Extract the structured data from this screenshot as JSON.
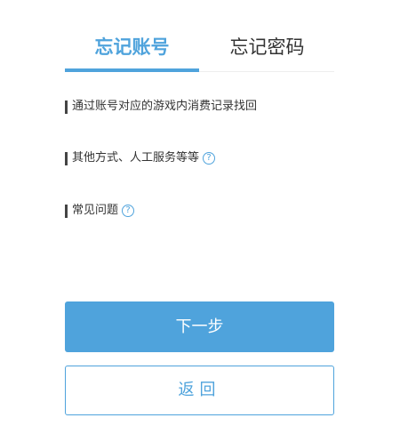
{
  "tabs": {
    "account_label": "忘记账号",
    "password_label": "忘记密码",
    "active": "account"
  },
  "options": [
    {
      "label": "通过账号对应的游戏内消费记录找回",
      "help_icon": false
    },
    {
      "label": "其他方式、人工服务等等",
      "help_icon": true
    },
    {
      "label": "常见问题",
      "help_icon": true
    }
  ],
  "buttons": {
    "next_label": "下一步",
    "back_label": "返回"
  },
  "colors": {
    "accent": "#4fa3dc",
    "text": "#333333"
  },
  "icons": {
    "help": "question-circle-icon"
  }
}
